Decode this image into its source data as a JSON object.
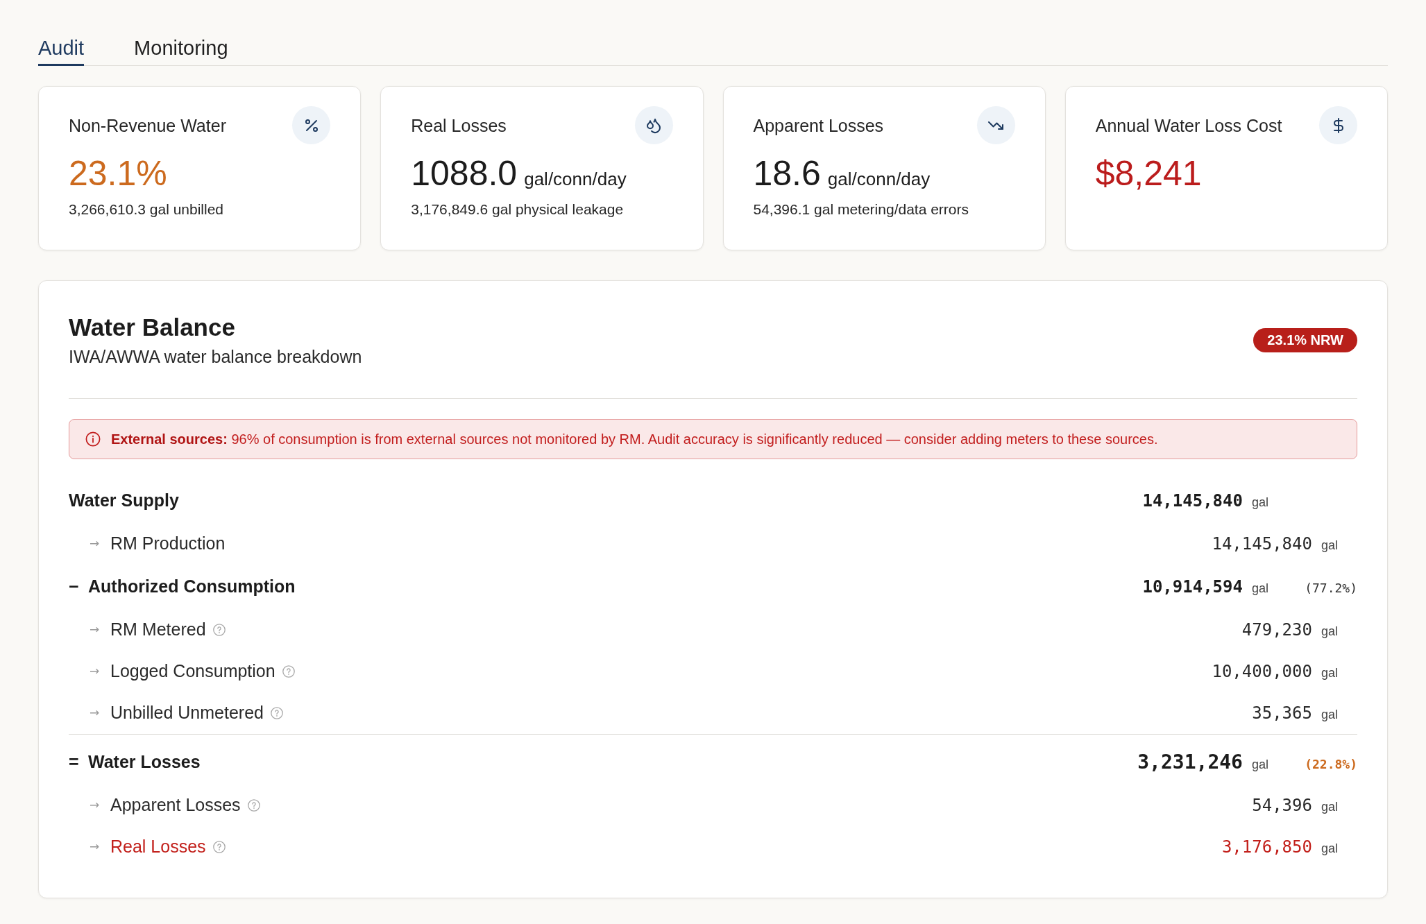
{
  "tabs": [
    {
      "label": "Audit",
      "selected": true
    },
    {
      "label": "Monitoring",
      "selected": false
    }
  ],
  "metric_cards": [
    {
      "label": "Non-Revenue Water",
      "value": "23.1%",
      "color": "#cc6a1e",
      "detail": "3,266,610.3 gal unbilled"
    },
    {
      "label": "Real Losses",
      "value": "1088.0",
      "unit": "gal/conn/day",
      "color": "#1c1c1c",
      "detail": "3,176,849.6 gal physical leakage"
    },
    {
      "label": "Apparent Losses",
      "value": "18.6",
      "unit": "gal/conn/day",
      "color": "#1c1c1c",
      "detail": "54,396.1 gal metering/data errors"
    },
    {
      "label": "Annual Water Loss Cost",
      "value": "$8,241",
      "color": "#bb1c1c"
    }
  ],
  "water_balance": {
    "title": "Water Balance",
    "subtitle": "IWA/AWWA water balance breakdown",
    "badge": "23.1% NRW",
    "alert": "**External sources:** 96% of consumption is from external sources not monitored by RM. Audit accuracy is significantly reduced — consider adding meters to these sources.",
    "rows": [
      {
        "kind": "total",
        "label": "Water Supply",
        "value": "14,145,840",
        "unit": "gal",
        "children": [
          {
            "marker": "→",
            "label": "RM Production",
            "value": "14,145,840",
            "unit": "gal",
            "help": false,
            "flagged": false
          }
        ]
      },
      {
        "kind": "total",
        "marker": "−",
        "label": "Authorized Consumption",
        "value": "10,914,594",
        "unit": "gal",
        "percent": "(77.2%)",
        "percent_flagged": false,
        "children": [
          {
            "marker": "→",
            "label": "RM Metered",
            "value": "479,230",
            "unit": "gal",
            "help": true,
            "flagged": false
          },
          {
            "marker": "→",
            "label": "Logged Consumption",
            "value": "10,400,000",
            "unit": "gal",
            "help": true,
            "flagged": false
          },
          {
            "marker": "→",
            "label": "Unbilled Unmetered",
            "value": "35,365",
            "unit": "gal",
            "help": true,
            "flagged": false
          }
        ]
      },
      {
        "kind": "result",
        "marker": "=",
        "label": "Water Losses",
        "value": "3,231,246",
        "unit": "gal",
        "percent": "(22.8%)",
        "percent_flagged": true,
        "children": [
          {
            "marker": "→",
            "label": "Apparent Losses",
            "value": "54,396",
            "unit": "gal",
            "help": true,
            "flagged": false
          },
          {
            "marker": "→",
            "label": "Real Losses",
            "value": "3,176,850",
            "unit": "gal",
            "help": true,
            "flagged": true
          }
        ]
      }
    ]
  }
}
